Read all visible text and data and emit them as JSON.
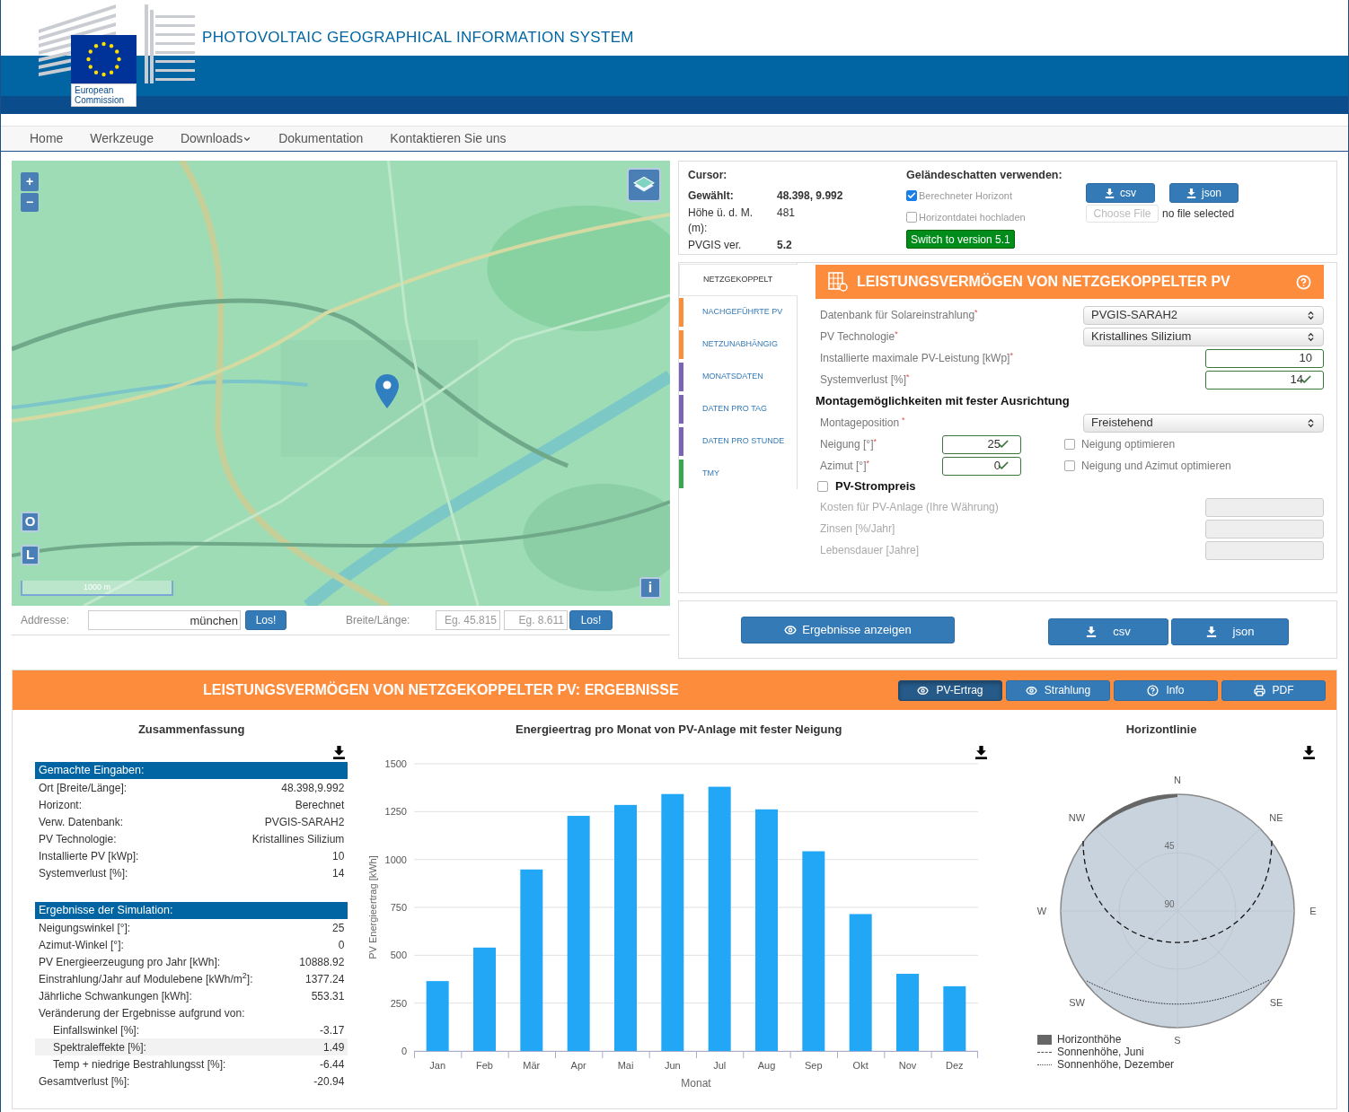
{
  "header": {
    "logo_text": "European Commission",
    "title": "PHOTOVOLTAIC GEOGRAPHICAL INFORMATION SYSTEM"
  },
  "nav": [
    {
      "label": "Home",
      "dropdown": false
    },
    {
      "label": "Werkzeuge",
      "dropdown": false
    },
    {
      "label": "Downloads",
      "dropdown": true
    },
    {
      "label": "Dokumentation",
      "dropdown": false
    },
    {
      "label": "Kontaktieren Sie uns",
      "dropdown": false
    }
  ],
  "map": {
    "zoom_in": "+",
    "zoom_out": "−",
    "layer_buttons": [
      "O",
      "L"
    ],
    "info": "i",
    "scale": "1000 m"
  },
  "address_bar": {
    "address_label": "Addresse:",
    "address_value": "münchen",
    "go": "Los!",
    "latlon_label": "Breite/Länge:",
    "lat_placeholder": "Eg. 45.815",
    "lon_placeholder": "Eg. 8.611",
    "go_latlon": "Los!"
  },
  "location": {
    "cursor_label": "Cursor:",
    "rows": [
      {
        "label": "Gewählt:",
        "value": "48.398, 9.992",
        "label_bold": true,
        "value_bold": true
      },
      {
        "label": "Höhe ü. d. M. (m):",
        "value": "481",
        "label_bold": false,
        "value_bold": false
      },
      {
        "label": "PVGIS ver.",
        "value": "5.2",
        "label_bold": false,
        "value_bold": true
      }
    ]
  },
  "horizon": {
    "title": "Geländeschatten verwenden:",
    "options": [
      {
        "label": "Berechneter Horizont",
        "checked": true
      },
      {
        "label": "Horizontdatei hochladen",
        "checked": false
      }
    ],
    "switch_button": "Switch to version 5.1",
    "downloads": [
      "csv",
      "json"
    ],
    "file_button": "Choose File",
    "file_status": "no file selected"
  },
  "tool_tabs": [
    {
      "label": "NETZGEKOPPELT",
      "selected": true
    },
    {
      "label": "NACHGEFÜHRTE PV",
      "selected": false,
      "color": "#f7903e"
    },
    {
      "label": "NETZUNABHÄNGIG",
      "selected": false,
      "color": "#f7903e"
    },
    {
      "label": "MONATSDATEN",
      "selected": false,
      "color": "#7c64b5"
    },
    {
      "label": "DATEN PRO TAG",
      "selected": false,
      "color": "#7c64b5"
    },
    {
      "label": "DATEN PRO STUNDE",
      "selected": false,
      "color": "#7c64b5"
    },
    {
      "label": "TMY",
      "selected": false,
      "color": "#3aa64f"
    }
  ],
  "form": {
    "title": "LEISTUNGSVERMÖGEN VON NETZGEKOPPELTER PV",
    "fields": [
      {
        "kind": "select",
        "label": "Datenbank für Solareinstrahlung",
        "mark": "*",
        "value": "PVGIS-SARAH2",
        "valid": false
      },
      {
        "kind": "select",
        "label": "PV Technologie",
        "mark": "*",
        "value": "Kristallines Silizium",
        "valid": false
      },
      {
        "kind": "input",
        "label": "Installierte maximale PV-Leistung [kWp]",
        "mark": "*",
        "value": "10",
        "valid": false
      },
      {
        "kind": "input",
        "label": "Systemverlust [%]",
        "mark": "*",
        "value": "14",
        "valid": true
      }
    ],
    "mounting_title": "Montagemöglichkeiten mit fester Ausrichtung",
    "position": {
      "label": "Montageposition",
      "mark": "*",
      "value": "Freistehend"
    },
    "angles": [
      {
        "label": "Neigung [°]",
        "mark": "*",
        "value": "25",
        "valid": true,
        "optimize": {
          "label": "Neigung optimieren",
          "checked": false
        }
      },
      {
        "label": "Azimut [°]",
        "mark": "*",
        "value": "0",
        "valid": true,
        "optimize": {
          "label": "Neigung und Azimut optimieren",
          "checked": false
        }
      }
    ],
    "price": {
      "label": "PV-Strompreis",
      "checked": false,
      "fields": [
        {
          "label": "Kosten für PV-Anlage (Ihre Währung)",
          "disabled": true
        },
        {
          "label": "Zinsen [%/Jahr]",
          "disabled": true
        },
        {
          "label": "Lebensdauer [Jahre]",
          "disabled": true
        }
      ]
    }
  },
  "actions": {
    "show": "Ergebnisse anzeigen",
    "downloads": [
      "csv",
      "json"
    ]
  },
  "results": {
    "title": "LEISTUNGSVERMÖGEN VON NETZGEKOPPELTER PV: ERGEBNISSE",
    "tabs": [
      {
        "label": "PV-Ertrag",
        "kind": "view",
        "selected": true
      },
      {
        "label": "Strahlung",
        "kind": "view",
        "selected": false
      },
      {
        "label": "Info",
        "kind": "info",
        "selected": false
      },
      {
        "label": "PDF",
        "kind": "print",
        "selected": false
      }
    ]
  },
  "summary": {
    "title": "Zusammenfassung",
    "sections": [
      {
        "heading": "Gemachte Eingaben:",
        "rows": [
          {
            "label": "Ort [Breite/Länge]:",
            "value": "48.398,9.992"
          },
          {
            "label": "Horizont:",
            "value": "Berechnet"
          },
          {
            "label": "Verw. Datenbank:",
            "value": "PVGIS-SARAH2"
          },
          {
            "label": "PV Technologie:",
            "value": "Kristallines Silizium"
          },
          {
            "label": "Installierte PV [kWp]:",
            "value": "10"
          },
          {
            "label": "Systemverlust [%]:",
            "value": "14"
          }
        ]
      },
      {
        "heading": "Ergebnisse der Simulation:",
        "rows": [
          {
            "label": "Neigungswinkel [°]:",
            "value": "25"
          },
          {
            "label": "Azimut-Winkel [°]:",
            "value": "0"
          },
          {
            "label": "PV Energieerzeugung pro Jahr [kWh]:",
            "value": "10888.92"
          },
          {
            "label": "Einstrahlung/Jahr auf Modulebene [kWh/m$^{2}$]:",
            "value": "1377.24"
          },
          {
            "label": "Jährliche Schwankungen [kWh]:",
            "value": "553.31"
          },
          {
            "label": "Veränderung der Ergebnisse aufgrund von:",
            "children": [
              {
                "label": "Einfallswinkel [%]:",
                "value": "-3.17",
                "highlighted": false
              },
              {
                "label": "Spektraleffekte [%]:",
                "value": "1.49",
                "highlighted": true
              },
              {
                "label": "Temp + niedrige Bestrahlungsst [%]:",
                "value": "-6.44",
                "highlighted": false
              }
            ]
          },
          {
            "label": "Gesamtverlust [%]:",
            "value": "-20.94"
          }
        ]
      }
    ]
  },
  "monthly_chart": {
    "title": "Energieertrag pro Monat von PV-Anlage mit fester Neigung",
    "chart_data": {
      "type": "bar",
      "xlabel": "Monat",
      "ylabel": "PV Energieertrag [kWh]",
      "categories": [
        "Jan",
        "Feb",
        "Mär",
        "Apr",
        "Mai",
        "Jun",
        "Jul",
        "Aug",
        "Sep",
        "Okt",
        "Nov",
        "Dez"
      ],
      "values": [
        365,
        540,
        948,
        1228,
        1285,
        1342,
        1380,
        1262,
        1043,
        715,
        403,
        338
      ],
      "ylim": [
        0,
        1500
      ],
      "grid": true,
      "yticks": [
        0,
        250,
        500,
        750,
        1000,
        1250,
        1500
      ]
    }
  },
  "horizon_chart": {
    "title": "Horizontlinie",
    "directions": [
      "N",
      "NE",
      "E",
      "SE",
      "S",
      "SW",
      "W",
      "NW"
    ],
    "rings": [
      "45",
      "90"
    ],
    "legend": [
      {
        "label": "Horizonthöhe",
        "kind": "area"
      },
      {
        "label": "Sonnenhöhe, Juni",
        "kind": "dashed"
      },
      {
        "label": "Sonnenhöhe, Dezember",
        "kind": "dotted"
      }
    ]
  }
}
